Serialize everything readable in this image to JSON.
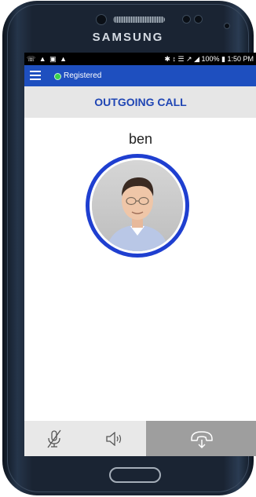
{
  "device": {
    "brand": "SAMSUNG"
  },
  "status_bar": {
    "left_icons": "☏ ▲ ▣ ▲",
    "right_text": "✱ ↕ ☰ ↗ ◢ 100% ▮ 1:50 PM"
  },
  "app_bar": {
    "registration_status": "Registered",
    "status_color": "#3ad24c",
    "accent": "#1e4fbf"
  },
  "call": {
    "state_title": "OUTGOING CALL",
    "caller_name": "ben"
  },
  "controls": {
    "mute": "mute-icon",
    "speaker": "speaker-icon",
    "end_call": "end-call-icon"
  }
}
